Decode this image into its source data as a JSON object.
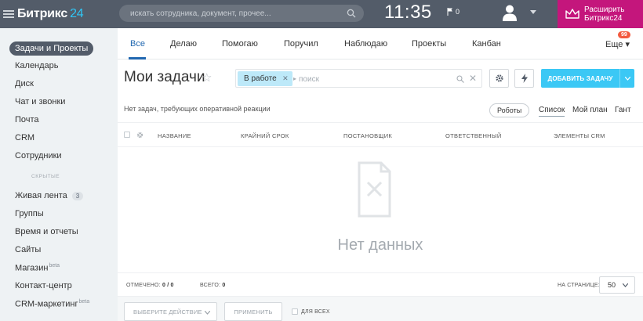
{
  "header": {
    "logo_main": "Битрикс",
    "logo_accent": "24",
    "search_placeholder": "искать сотрудника, документ, прочее...",
    "clock": "11:35",
    "flag_count": "0",
    "upgrade_label": "Расширить\nБитрикс24",
    "upgrade_color": "#c4167c",
    "bar_color": "#535c69"
  },
  "sidebar": {
    "items": [
      {
        "label": "Задачи и Проекты",
        "active": true
      },
      {
        "label": "Календарь"
      },
      {
        "label": "Диск"
      },
      {
        "label": "Чат и звонки"
      },
      {
        "label": "Почта"
      },
      {
        "label": "CRM"
      },
      {
        "label": "Сотрудники"
      }
    ],
    "hidden_label": "СКРЫТЫЕ",
    "hidden_items": [
      {
        "label": "Живая лента",
        "badge": "3"
      },
      {
        "label": "Группы"
      },
      {
        "label": "Время и отчеты"
      },
      {
        "label": "Сайты"
      },
      {
        "label": "Магазин",
        "sup": "beta"
      },
      {
        "label": "Контакт-центр"
      },
      {
        "label": "CRM-маркетинг",
        "sup": "beta"
      }
    ]
  },
  "tabs": {
    "items": [
      "Все",
      "Делаю",
      "Помогаю",
      "Поручил",
      "Наблюдаю",
      "Проекты",
      "Канбан"
    ],
    "active": "Все",
    "more_label": "Еще",
    "more_badge": "99"
  },
  "toolbar": {
    "title": "Мои задачи",
    "filter_chip": "В работе",
    "filter_placeholder": "поиск",
    "add_label": "ДОБАВИТЬ ЗАДАЧУ",
    "accent_color": "#3bc8f5"
  },
  "subbar": {
    "notice": "Нет задач, требующих оперативной реакции",
    "robots_label": "Роботы",
    "views": [
      "Список",
      "Мой план",
      "Гант"
    ],
    "active_view": "Список"
  },
  "table": {
    "columns": [
      "НАЗВАНИЕ",
      "КРАЙНИЙ СРОК",
      "ПОСТАНОВЩИК",
      "ОТВЕТСТВЕННЫЙ",
      "ЭЛЕМЕНТЫ CRM"
    ],
    "empty_text": "Нет данных"
  },
  "footer": {
    "selected_label": "ОТМЕЧЕНО:",
    "selected_value": "0 / 0",
    "total_label": "ВСЕГО:",
    "total_value": "0",
    "per_page_label": "НА СТРАНИЦЕ:",
    "per_page_value": "50"
  },
  "actions": {
    "select_placeholder": "ВЫБЕРИТЕ ДЕЙСТВИЕ",
    "apply_label": "ПРИМЕНИТЬ",
    "for_all_label": "ДЛЯ ВСЕХ"
  }
}
